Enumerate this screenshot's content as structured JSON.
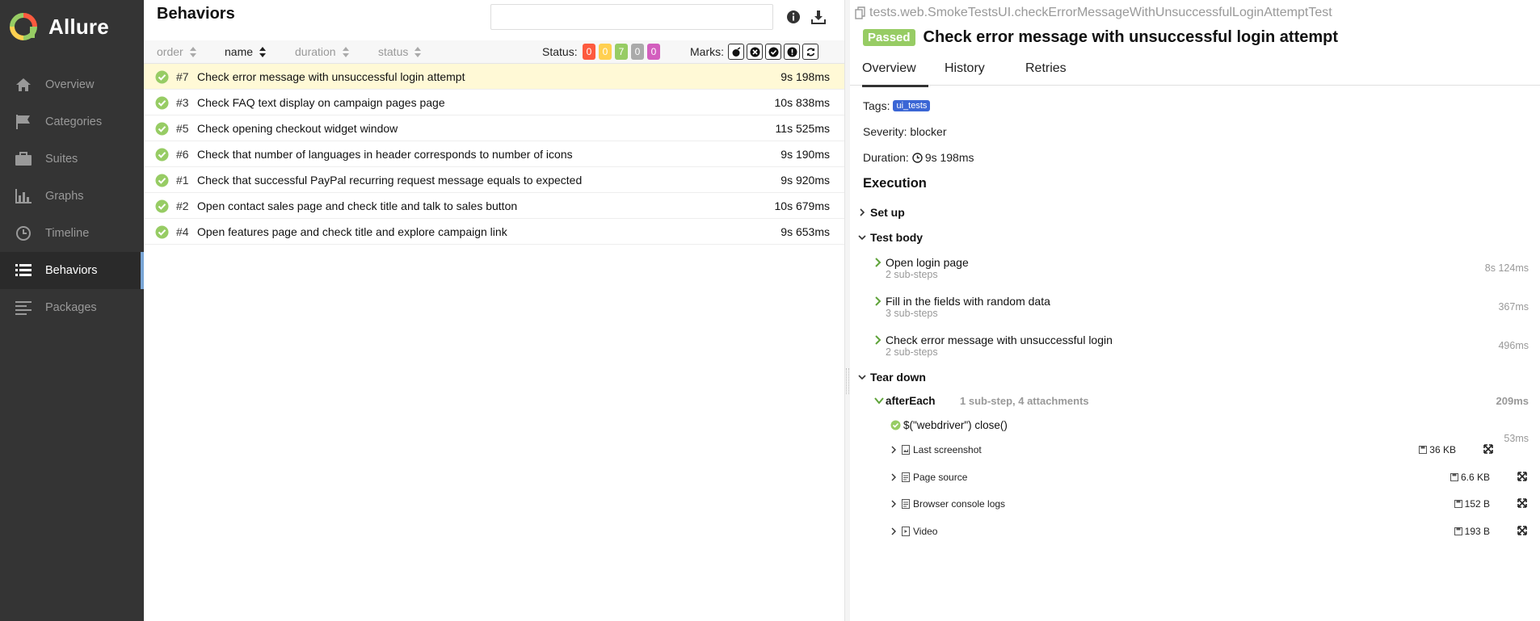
{
  "app": {
    "name": "Allure"
  },
  "sidebar": {
    "items": [
      {
        "label": "Overview",
        "icon": "home-icon"
      },
      {
        "label": "Categories",
        "icon": "flag-icon"
      },
      {
        "label": "Suites",
        "icon": "briefcase-icon"
      },
      {
        "label": "Graphs",
        "icon": "bar-chart-icon"
      },
      {
        "label": "Timeline",
        "icon": "clock-icon"
      },
      {
        "label": "Behaviors",
        "icon": "list-icon",
        "active": true
      },
      {
        "label": "Packages",
        "icon": "align-left-icon"
      }
    ]
  },
  "behaviors": {
    "title": "Behaviors",
    "search": {
      "value": "",
      "placeholder": ""
    },
    "sort": {
      "order": "order",
      "name": "name",
      "duration": "duration",
      "status": "status"
    },
    "status_label": "Status:",
    "status_counts": [
      {
        "value": "0",
        "color": "#fd5a3e"
      },
      {
        "value": "0",
        "color": "#ffd050"
      },
      {
        "value": "7",
        "color": "#97cc64"
      },
      {
        "value": "0",
        "color": "#aaaaaa"
      },
      {
        "value": "0",
        "color": "#d35ebe"
      }
    ],
    "marks_label": "Marks:",
    "marks": [
      "flaky-icon",
      "new-failed-icon",
      "new-passed-icon",
      "new-broken-icon",
      "retries-icon"
    ],
    "rows": [
      {
        "order": "#7",
        "name": "Check error message with unsuccessful login attempt",
        "duration": "9s 198ms",
        "selected": true
      },
      {
        "order": "#3",
        "name": "Check FAQ text display on campaign pages page",
        "duration": "10s 838ms"
      },
      {
        "order": "#5",
        "name": "Check opening checkout widget window",
        "duration": "11s 525ms"
      },
      {
        "order": "#6",
        "name": "Check that number of languages in header corresponds to number of icons",
        "duration": "9s 190ms"
      },
      {
        "order": "#1",
        "name": "Check that successful PayPal recurring request message equals to expected",
        "duration": "9s 920ms"
      },
      {
        "order": "#2",
        "name": "Open contact sales page and check title and talk to sales button",
        "duration": "10s 679ms"
      },
      {
        "order": "#4",
        "name": "Open features page and check title and explore campaign link",
        "duration": "9s 653ms"
      }
    ]
  },
  "detail": {
    "full_name": "tests.web.SmokeTestsUI.checkErrorMessageWithUnsuccessfulLoginAttemptTest",
    "status": "Passed",
    "title": "Check error message with unsuccessful login attempt",
    "tabs": [
      "Overview",
      "History",
      "Retries"
    ],
    "tags_label": "Tags:",
    "tag": "ui_tests",
    "severity_label": "Severity: blocker",
    "duration_label": "Duration:",
    "duration": "9s 198ms",
    "execution_title": "Execution",
    "setup_label": "Set up",
    "body_label": "Test body",
    "steps": [
      {
        "name": "Open login page",
        "sub": "2 sub-steps",
        "time": "8s 124ms"
      },
      {
        "name": "Fill in the fields with random data",
        "sub": "3 sub-steps",
        "time": "367ms"
      },
      {
        "name": "Check error message with unsuccessful login",
        "sub": "2 sub-steps",
        "time": "496ms"
      }
    ],
    "teardown_label": "Tear down",
    "after_each": {
      "name": "afterEach",
      "meta": "1 sub-step, 4 attachments",
      "time": "209ms"
    },
    "substep": {
      "name": "$(\"webdriver\") close()",
      "time": "53ms"
    },
    "attachments": [
      {
        "name": "Last screenshot",
        "size": "36 KB",
        "icon": "image-file-icon"
      },
      {
        "name": "Page source",
        "size": "6.6 KB",
        "icon": "text-file-icon"
      },
      {
        "name": "Browser console logs",
        "size": "152 B",
        "icon": "text-file-icon"
      },
      {
        "name": "Video",
        "size": "193 B",
        "icon": "video-file-icon"
      }
    ]
  }
}
